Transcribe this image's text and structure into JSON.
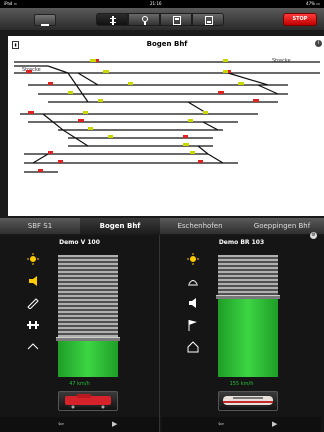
{
  "statusbar": {
    "left": "iPad ≈",
    "time": "21:16",
    "right": "47% ▭"
  },
  "toolbar": {
    "segments": [
      "track-icon",
      "loco-icon",
      "switch-icon",
      "layout-icon"
    ],
    "stop_label": "STOP"
  },
  "track": {
    "title": "Bogen Bhf",
    "label_left": "Strecke",
    "label_right": "Strecke"
  },
  "tabs": [
    "SBF S1",
    "Bogen Bhf",
    "Eschenhofen",
    "Goeppingen Bhf"
  ],
  "controllers": [
    {
      "name": "Demo V 100",
      "speed": "47 km/h",
      "level": 0.3
    },
    {
      "name": "Demo BR 103",
      "speed": "155 km/h",
      "level": 0.65
    }
  ],
  "colors": {
    "accent": "#29c13a",
    "stop": "#e60000",
    "light": "#ffcc00"
  }
}
